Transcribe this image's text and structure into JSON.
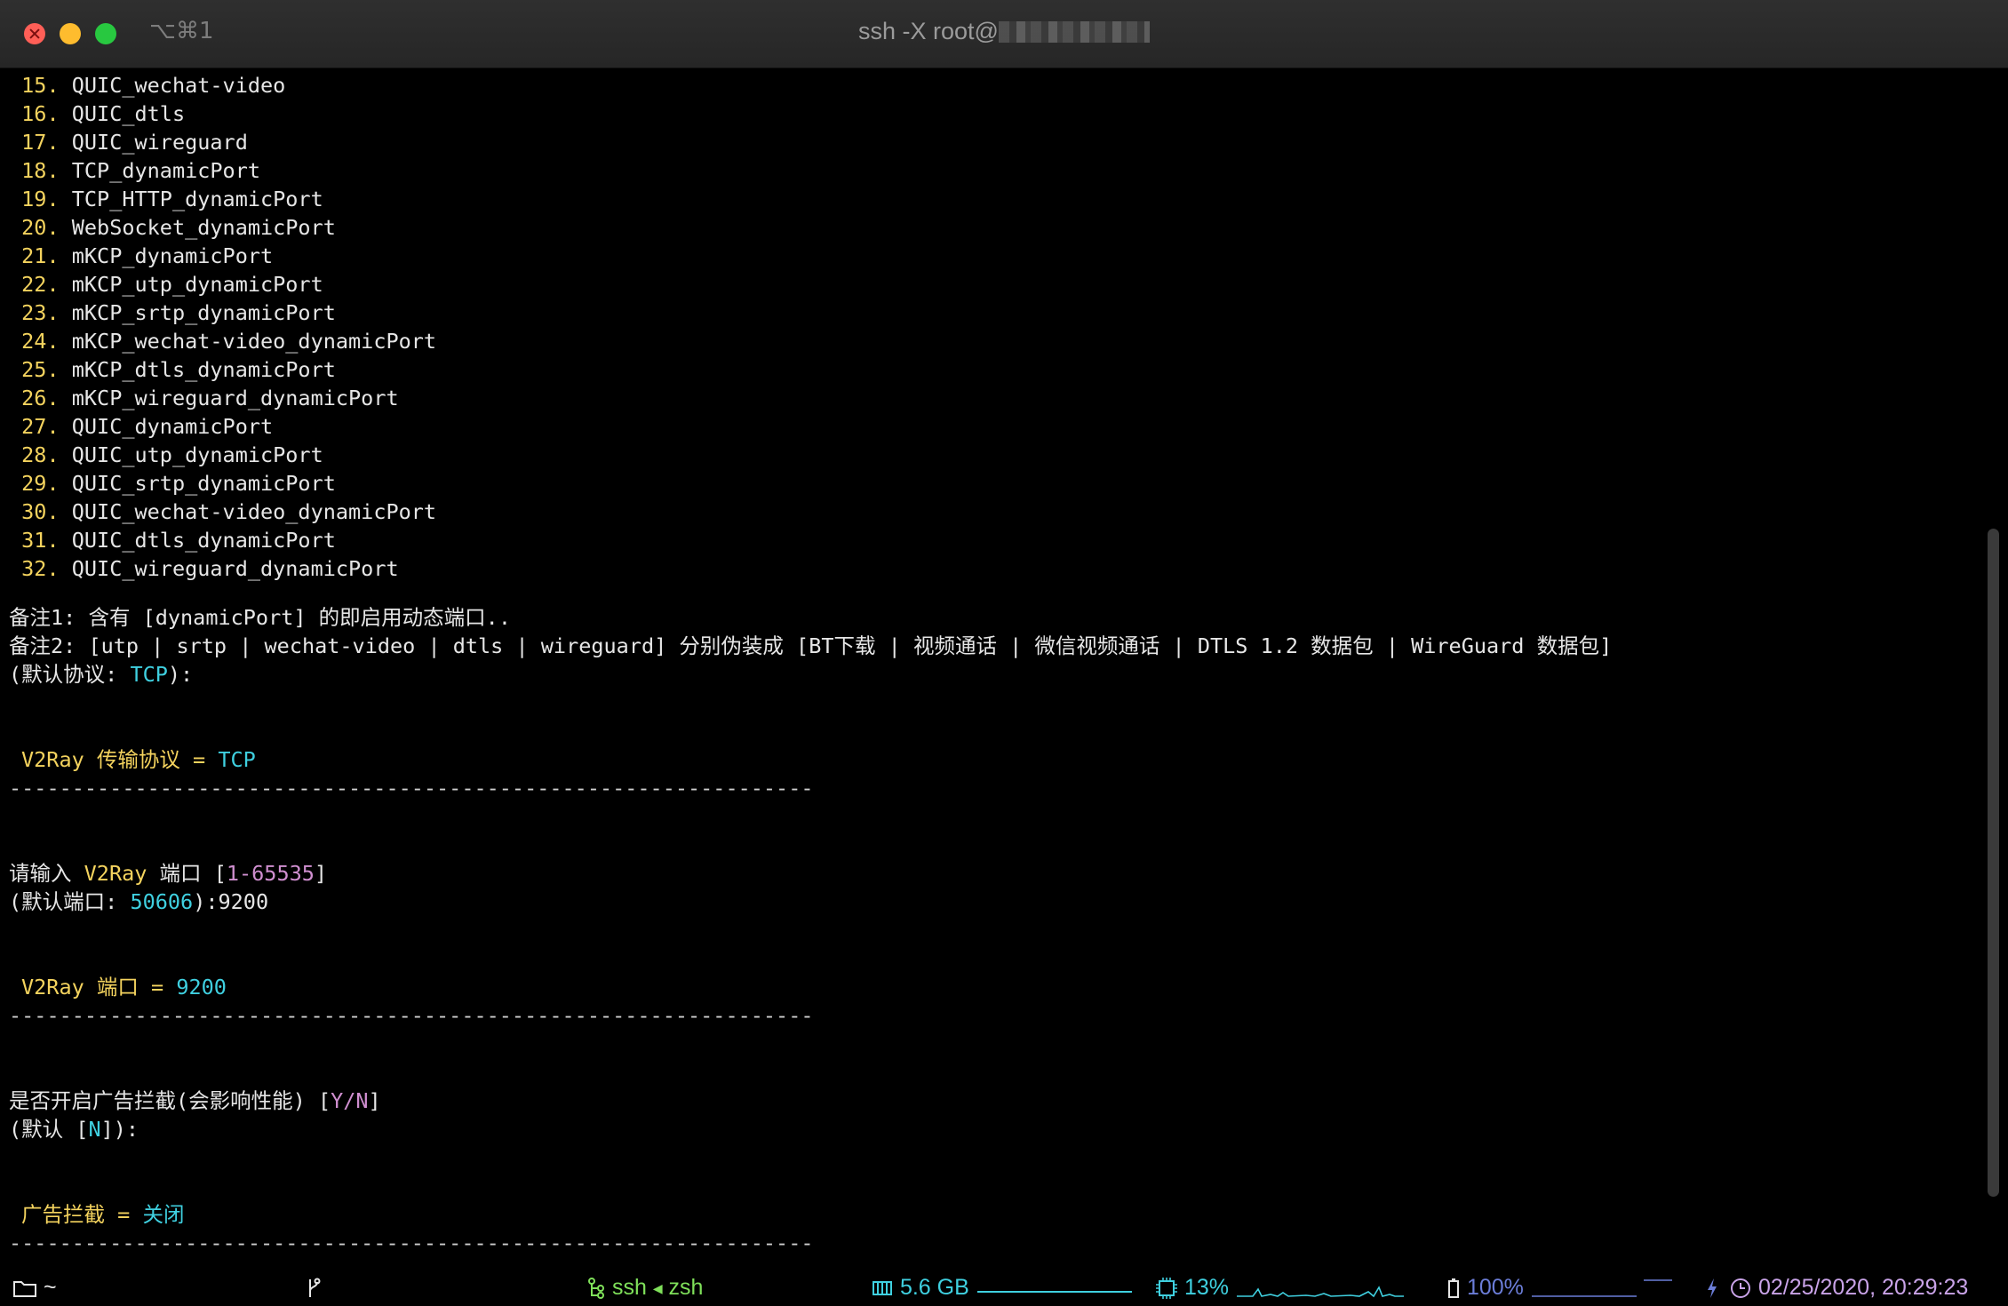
{
  "window": {
    "shortcut": "⌥⌘1",
    "title": "ssh -X root@"
  },
  "list": [
    {
      "n": "15.",
      "label": "QUIC_wechat-video"
    },
    {
      "n": "16.",
      "label": "QUIC_dtls"
    },
    {
      "n": "17.",
      "label": "QUIC_wireguard"
    },
    {
      "n": "18.",
      "label": "TCP_dynamicPort"
    },
    {
      "n": "19.",
      "label": "TCP_HTTP_dynamicPort"
    },
    {
      "n": "20.",
      "label": "WebSocket_dynamicPort"
    },
    {
      "n": "21.",
      "label": "mKCP_dynamicPort"
    },
    {
      "n": "22.",
      "label": "mKCP_utp_dynamicPort"
    },
    {
      "n": "23.",
      "label": "mKCP_srtp_dynamicPort"
    },
    {
      "n": "24.",
      "label": "mKCP_wechat-video_dynamicPort"
    },
    {
      "n": "25.",
      "label": "mKCP_dtls_dynamicPort"
    },
    {
      "n": "26.",
      "label": "mKCP_wireguard_dynamicPort"
    },
    {
      "n": "27.",
      "label": "QUIC_dynamicPort"
    },
    {
      "n": "28.",
      "label": "QUIC_utp_dynamicPort"
    },
    {
      "n": "29.",
      "label": "QUIC_srtp_dynamicPort"
    },
    {
      "n": "30.",
      "label": "QUIC_wechat-video_dynamicPort"
    },
    {
      "n": "31.",
      "label": "QUIC_dtls_dynamicPort"
    },
    {
      "n": "32.",
      "label": "QUIC_wireguard_dynamicPort"
    }
  ],
  "notes": {
    "note1": "备注1: 含有 [dynamicPort] 的即启用动态端口..",
    "note2": "备注2: [utp | srtp | wechat-video | dtls | wireguard] 分别伪装成 [BT下载 | 视频通话 | 微信视频通话 | DTLS 1.2 数据包 | WireGuard 数据包]"
  },
  "protocol": {
    "default_prefix": "(默认协议: ",
    "default_value": "TCP",
    "default_suffix": "):",
    "result_label": "V2Ray 传输协议 = ",
    "result_value": "TCP"
  },
  "separator": "----------------------------------------------------------------",
  "port": {
    "prompt_prefix": "请输入 ",
    "prompt_name": "V2Ray",
    "prompt_mid": " 端口 [",
    "prompt_range": "1-65535",
    "prompt_suffix": "]",
    "default_prefix": "(默认端口: ",
    "default_value": "50606",
    "default_suffix": "):9200",
    "result_label": "V2Ray 端口 = ",
    "result_value": "9200"
  },
  "adblock": {
    "prompt_prefix": "是否开启广告拦截(会影响性能) [",
    "prompt_choice": "Y/N",
    "prompt_suffix": "]",
    "default_prefix": "(默认 [",
    "default_value": "N",
    "default_suffix": "]):",
    "result_label": "广告拦截 = ",
    "result_value": "关闭"
  },
  "statusbar": {
    "cwd": "~",
    "session": "ssh",
    "shell": "zsh",
    "memory": "5.6 GB",
    "cpu": "13%",
    "battery": "100%",
    "datetime": "02/25/2020, 20:29:23",
    "colors": {
      "cwd": "#e6e6e6",
      "session": "#7fe05a",
      "memory": "#3fd0e0",
      "cpu": "#3fd0e0",
      "battery": "#6b7dd8",
      "datetime": "#c9a3e8"
    }
  }
}
